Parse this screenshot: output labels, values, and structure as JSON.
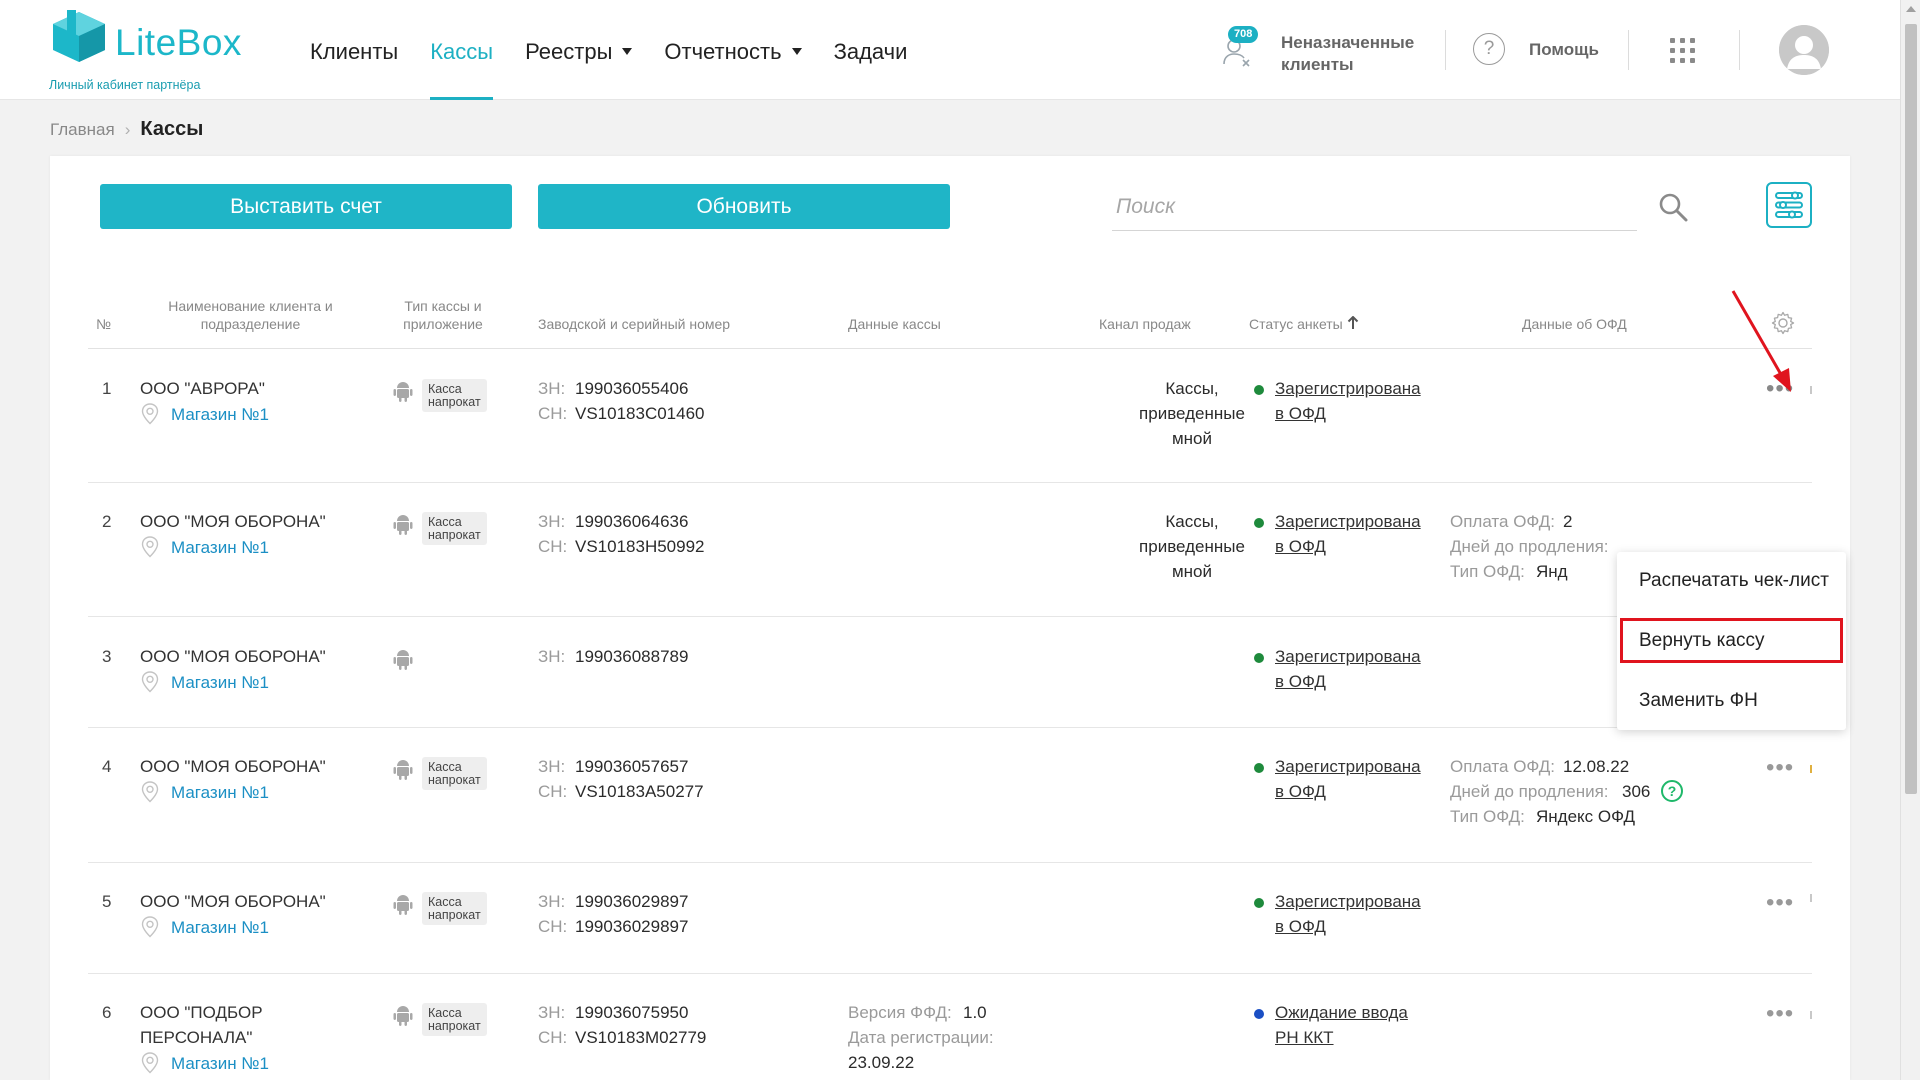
{
  "header": {
    "logo_text": "LiteBox",
    "logo_subtitle": "Личный кабинет партнёра",
    "nav": [
      {
        "label": "Клиенты",
        "active": false,
        "dropdown": false
      },
      {
        "label": "Кассы",
        "active": true,
        "dropdown": false
      },
      {
        "label": "Реестры",
        "active": false,
        "dropdown": true
      },
      {
        "label": "Отчетность",
        "active": false,
        "dropdown": true
      },
      {
        "label": "Задачи",
        "active": false,
        "dropdown": false
      }
    ],
    "unassigned_count": "708",
    "unassigned_line1": "Неназначенные",
    "unassigned_line2": "клиенты",
    "help_label": "Помощь",
    "help_symbol": "?"
  },
  "breadcrumb": {
    "home": "Главная",
    "separator": "›",
    "current": "Кассы"
  },
  "toolbar": {
    "invoice_button": "Выставить счет",
    "refresh_button": "Обновить",
    "search_placeholder": "Поиск"
  },
  "table": {
    "headers": {
      "num": "№",
      "client_line1": "Наименование клиента и",
      "client_line2": "подразделение",
      "type_line1": "Тип кассы и",
      "type_line2": "приложение",
      "serial": "Заводской и серийный номер",
      "kassa_data": "Данные кассы",
      "channel": "Канал продаж",
      "status": "Статус анкеты",
      "ofd": "Данные об ОФД"
    },
    "labels": {
      "zn": "ЗН:",
      "sn": "СН:",
      "ffd_version": "Версия ФФД:",
      "reg_date": "Дата регистрации:",
      "ofd_pay": "Оплата ОФД:",
      "ofd_days": "Дней до продления:",
      "ofd_type": "Тип ОФД:",
      "kassa_tag_line1": "Касса",
      "kassa_tag_line2": "напрокат",
      "dots": "•••"
    },
    "rows": [
      {
        "num": "1",
        "client": "ООО \"АВРОРА\"",
        "store": "Магазин №1",
        "zn": "199036055406",
        "sn": "VS10183C01460",
        "channel1": "Кассы,",
        "channel2": "приведенные",
        "channel3": "мной",
        "status1": "Зарегистрирована",
        "status2": "в ОФД",
        "status_color": "#1e8a3c"
      },
      {
        "num": "2",
        "client": "ООО \"МОЯ ОБОРОНА\"",
        "store": "Магазин №1",
        "zn": "199036064636",
        "sn": "VS10183H50992",
        "channel1": "Кассы,",
        "channel2": "приведенные",
        "channel3": "мной",
        "status1": "Зарегистрирована",
        "status2": "в ОФД",
        "status_color": "#1e8a3c",
        "ofd_pay": "2",
        "ofd_type": "Янд"
      },
      {
        "num": "3",
        "client": "ООО \"МОЯ ОБОРОНА\"",
        "store": "Магазин №1",
        "zn": "199036088789",
        "status1": "Зарегистрирована",
        "status2": "в ОФД",
        "status_color": "#1e8a3c"
      },
      {
        "num": "4",
        "client": "ООО \"МОЯ ОБОРОНА\"",
        "store": "Магазин №1",
        "zn": "199036057657",
        "sn": "VS10183A50277",
        "status1": "Зарегистрирована",
        "status2": "в ОФД",
        "status_color": "#1e8a3c",
        "ofd_pay": "12.08.22",
        "ofd_days": "306",
        "ofd_type": "Яндекс ОФД",
        "ofd_help": "?"
      },
      {
        "num": "5",
        "client": "ООО \"МОЯ ОБОРОНА\"",
        "store": "Магазин №1",
        "zn": "199036029897",
        "sn": "199036029897",
        "status1": "Зарегистрирована",
        "status2": "в ОФД",
        "status_color": "#1e8a3c"
      },
      {
        "num": "6",
        "client1": "ООО \"ПОДБОР",
        "client2": "ПЕРСОНАЛА\"",
        "store": "Магазин №1",
        "zn": "199036075950",
        "sn": "VS10183M02779",
        "ffd_version": "1.0",
        "reg_date": "23.09.22",
        "status1": "Ожидание ввода",
        "status2": "РН ККТ",
        "status_color": "#1a4fc4"
      }
    ]
  },
  "context_menu": {
    "items": [
      "Распечатать чек-лист",
      "Вернуть кассу",
      "Заменить ФН"
    ],
    "highlighted": "Вернуть кассу"
  },
  "colors": {
    "accent": "#1cb0c3",
    "link": "#1b8fc4",
    "annotation_red": "#e0141e"
  }
}
